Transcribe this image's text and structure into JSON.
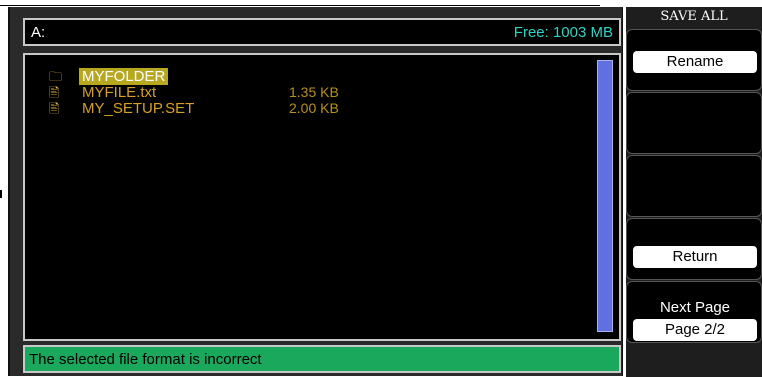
{
  "address_bar": {
    "path": "A:",
    "free_space": "Free: 1003 MB"
  },
  "files": [
    {
      "icon": "folder-icon",
      "glyph": "🗀",
      "name": "MYFOLDER",
      "size": "",
      "selected": true
    },
    {
      "icon": "file-icon",
      "glyph": "🖹",
      "name": "MYFILE.txt",
      "size": "1.35 KB",
      "selected": false
    },
    {
      "icon": "file-icon",
      "glyph": "🖹",
      "name": "MY_SETUP.SET",
      "size": "2.00 KB",
      "selected": false
    }
  ],
  "status_message": "The selected file format is incorrect",
  "menu": {
    "title": "SAVE ALL",
    "rename_label": "Rename",
    "return_label": "Return",
    "next_page_label": "Next Page",
    "page_indicator": "Page 2/2"
  },
  "colors": {
    "status_bar": "#19a85c",
    "free_space_text": "#2bd4c4",
    "file_text": "#d8a020",
    "selection": "#b8a820",
    "scrollbar": "#6070e0"
  }
}
